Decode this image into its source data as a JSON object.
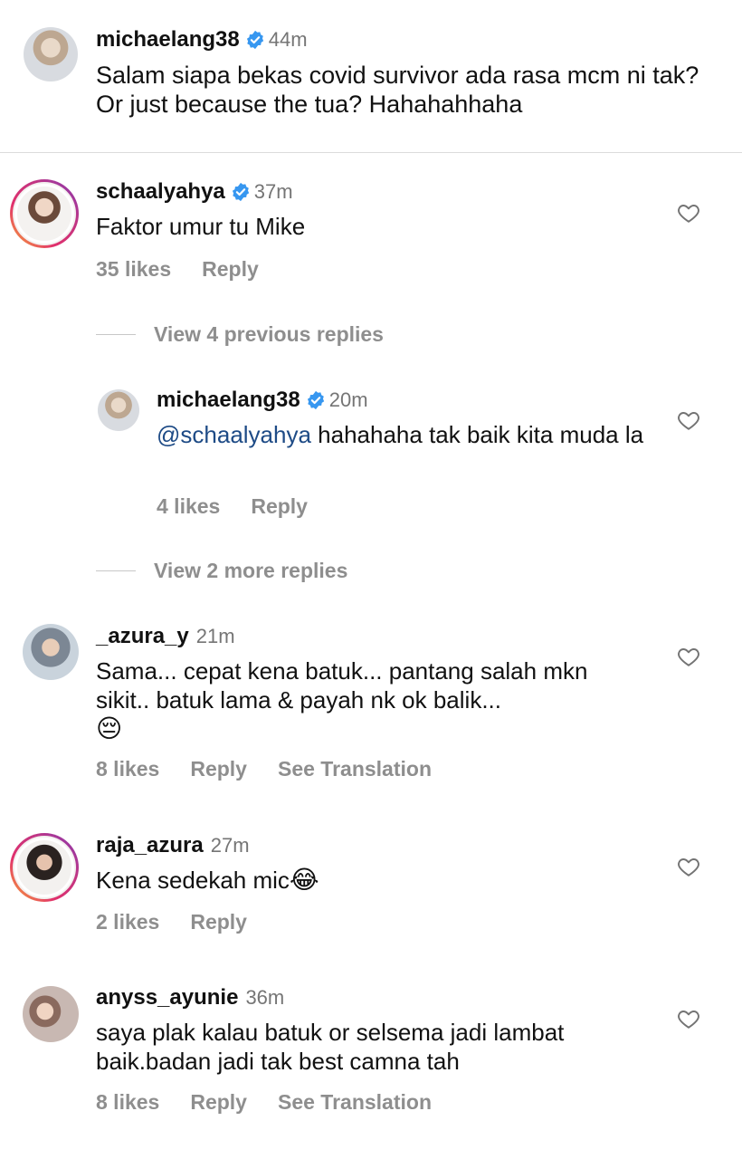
{
  "caption": {
    "username": "michaelang38",
    "time": "44m",
    "text": "Salam siapa bekas covid survivor ada rasa mcm ni tak? Or just because the tua? Hahahahhaha"
  },
  "comments": [
    {
      "username": "schaalyahya",
      "time": "37m",
      "text": "Faktor umur tu Mike",
      "likes": "35 likes",
      "reply": "Reply"
    },
    {
      "view_previous": "View 4 previous replies"
    },
    {
      "username": "michaelang38",
      "time": "20m",
      "mention": "@schaalyahya",
      "text": " hahahaha tak baik kita muda la",
      "likes": "4 likes",
      "reply": "Reply"
    },
    {
      "view_more": "View 2 more replies"
    },
    {
      "username": "_azura_y",
      "time": "21m",
      "text": "Sama... cepat kena batuk... pantang salah mkn sikit.. batuk lama & payah nk ok balik...",
      "emoji": "😔",
      "likes": "8 likes",
      "reply": "Reply",
      "translate": "See Translation"
    },
    {
      "username": "raja_azura",
      "time": "27m",
      "text": "Kena sedekah mic",
      "emoji": "😂",
      "likes": "2 likes",
      "reply": "Reply"
    },
    {
      "username": "anyss_ayunie",
      "time": "36m",
      "text": "saya plak kalau batuk or selsema jadi lambat baik.badan jadi tak best camna tah",
      "likes": "8 likes",
      "reply": "Reply",
      "translate": "See Translation"
    }
  ],
  "icons": {
    "verified": "verified-badge-icon",
    "heart": "heart-outline-icon"
  },
  "colors": {
    "verified": "#3797f0",
    "mention": "#1e4b86",
    "muted": "#8e8e8e"
  }
}
